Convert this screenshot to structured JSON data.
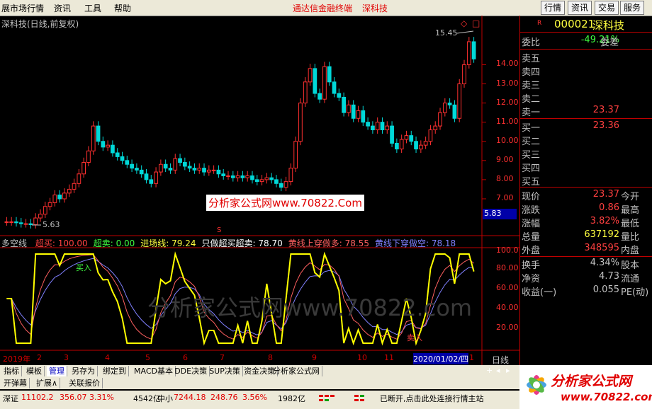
{
  "menubar": {
    "items": [
      "展市场行情",
      "资讯",
      "工具",
      "帮助"
    ],
    "center_title": "通达信金融终端",
    "center_sub": "深科技",
    "right_buttons": [
      "行情",
      "资讯",
      "交易",
      "服务"
    ]
  },
  "chart": {
    "title": "深科技(日线,前复权)",
    "high_label": "15.45",
    "low_label": "5.63",
    "watermark": "分析家公式网www.70822.Com",
    "price_ticks": [
      "14.00",
      "13.00",
      "12.00",
      "11.00",
      "10.00",
      "9.00",
      "8.00",
      "7.00"
    ],
    "current_price_box": "5.83",
    "indicator": {
      "name": "多空线",
      "items": [
        {
          "label": "超买:",
          "value": "100.00",
          "color": "#ff4040"
        },
        {
          "label": "超卖:",
          "value": "0.00",
          "color": "#40ff40"
        },
        {
          "label": "进场线:",
          "value": "79.24",
          "color": "#ffff40"
        },
        {
          "label": "只做超买超卖:",
          "value": "78.70",
          "color": "#ffffff"
        },
        {
          "label": "黄线上穿做多:",
          "value": "78.55",
          "color": "#ff6060"
        },
        {
          "label": "黄线下穿做空:",
          "value": "78.18",
          "color": "#8080ff"
        }
      ],
      "ticks": [
        "100.0",
        "80.00",
        "60.00",
        "40.00",
        "20.00"
      ],
      "marker_top": "买入",
      "marker_bottom": "卖入",
      "watermark": "分析家公式网www.70822.com"
    },
    "xaxis": [
      "2019年",
      "2",
      "3",
      "4",
      "5",
      "6",
      "7",
      "8",
      "9",
      "10",
      "11",
      "2020/01/02/四",
      "1"
    ],
    "period": "日线",
    "chart_data": {
      "type": "candlestick",
      "title": "深科技(日线,前复权)",
      "ylim": [
        5.3,
        15.9
      ],
      "high": 15.45,
      "low": 5.63,
      "last": 14.3,
      "series": [
        {
          "name": "close",
          "values": [
            5.8,
            5.8,
            5.75,
            5.7,
            5.7,
            5.65,
            6.0,
            6.2,
            6.6,
            6.8,
            7.2,
            7.0,
            7.3,
            7.5,
            7.8,
            8.3,
            8.9,
            9.5,
            10.8,
            10.0,
            9.7,
            9.8,
            9.4,
            9.2,
            9.0,
            8.8,
            8.6,
            8.5,
            8.3,
            8.0,
            7.8,
            8.4,
            8.8,
            8.6,
            8.5,
            9.1,
            8.9,
            8.7,
            8.6,
            8.5,
            8.6,
            8.4,
            8.5,
            8.5,
            8.3,
            8.2,
            8.2,
            8.1,
            8.2,
            8.1,
            8.2,
            8.0,
            7.9,
            8.0,
            8.1,
            8.0,
            7.8,
            7.6,
            7.9,
            8.6,
            10.0,
            12.0,
            13.1,
            13.8,
            12.5,
            12.2,
            13.9,
            13.1,
            12.5,
            12.3,
            11.5,
            11.9,
            11.2,
            11.6,
            11.0,
            10.8,
            10.6,
            11.0,
            10.6,
            10.8,
            9.9,
            9.6,
            10.1,
            10.3,
            10.0,
            9.6,
            9.8,
            10.0,
            10.6,
            10.8,
            11.5,
            12.0,
            11.9,
            11.2,
            13.0,
            14.0,
            15.2,
            14.3
          ]
        }
      ]
    }
  },
  "panel": {
    "code": "000021",
    "name": "深科技",
    "weibi_label": "委比",
    "weibi_value": "-49.21%",
    "weicha_label": "委差",
    "sell_labels": [
      "卖五",
      "卖四",
      "卖三",
      "卖二",
      "卖一"
    ],
    "sell1_price": "23.37",
    "buy_labels": [
      "买一",
      "买二",
      "买三",
      "买四",
      "买五"
    ],
    "buy1_price": "23.36",
    "rows": [
      {
        "l": "现价",
        "v": "23.37",
        "c": "red",
        "r": "今开"
      },
      {
        "l": "涨跌",
        "v": "0.86",
        "c": "red",
        "r": "最高"
      },
      {
        "l": "涨幅",
        "v": "3.82%",
        "c": "red",
        "r": "最低"
      },
      {
        "l": "总量",
        "v": "637192",
        "c": "yellow",
        "r": "量比"
      },
      {
        "l": "外盘",
        "v": "348595",
        "c": "red",
        "r": "内盘"
      },
      {
        "l": "换手",
        "v": "4.34%",
        "c": "",
        "r": "股本"
      },
      {
        "l": "净资",
        "v": "4.73",
        "c": "",
        "r": "流通"
      },
      {
        "l": "收益(一)",
        "v": "0.055",
        "c": "",
        "r": "PE(动)"
      }
    ],
    "r_marker": "R"
  },
  "tabs1": [
    "指标",
    "模板",
    "管理",
    "另存为",
    "绑定到",
    "MACD基本",
    "DDE决策",
    "SUP决策",
    "资金决策",
    "分析家公式网"
  ],
  "tabs1_active": 2,
  "tabs2": [
    "开弹幕",
    "扩展∧",
    "关联报价"
  ],
  "status": {
    "shen_label": "深证",
    "shen_value": "11102.2",
    "shen_change": "356.07",
    "shen_pct": "3.31%",
    "shen_amount": "4542亿",
    "zx_label": "中小",
    "zx_value": "7244.18",
    "zx_change": "248.76",
    "zx_pct": "3.56%",
    "zx_amount": "1982亿",
    "disconnected": "已断开,点击此处连接行情主站"
  },
  "logo": {
    "text": "分析家公式网",
    "url": "www.70822.com"
  },
  "colors": {
    "up": "#ff3030",
    "down": "#00d8d8",
    "grid": "#c00000",
    "yellow": "#ffff00"
  }
}
